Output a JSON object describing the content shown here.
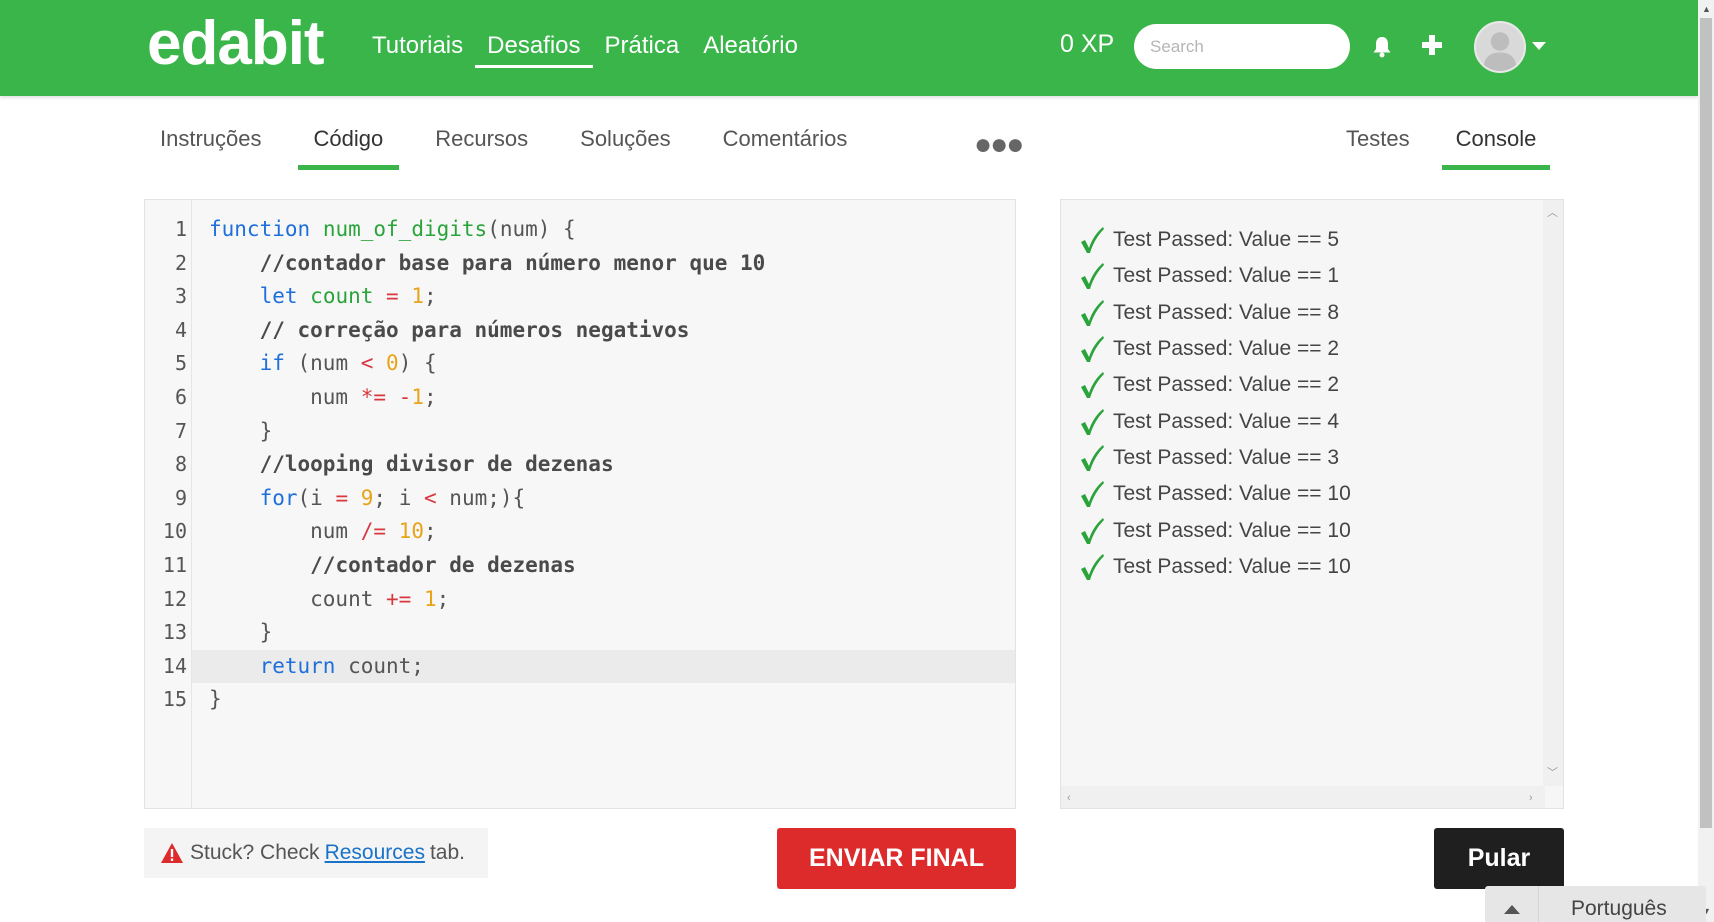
{
  "brand": {
    "logo": "edabit",
    "accent": "#39b54a"
  },
  "nav": [
    {
      "label": "Tutoriais",
      "active": false
    },
    {
      "label": "Desafios",
      "active": true
    },
    {
      "label": "Prática",
      "active": false
    },
    {
      "label": "Aleatório",
      "active": false
    }
  ],
  "header": {
    "xp": "0 XP",
    "search_placeholder": "Search",
    "icons": [
      "bell-icon",
      "plus-icon",
      "avatar",
      "caret-down-icon"
    ]
  },
  "tabs_left": [
    {
      "label": "Instruções",
      "active": false
    },
    {
      "label": "Código",
      "active": true
    },
    {
      "label": "Recursos",
      "active": false
    },
    {
      "label": "Soluções",
      "active": false
    },
    {
      "label": "Comentários",
      "active": false
    }
  ],
  "more_label": "●●●",
  "tabs_right": [
    {
      "label": "Testes",
      "active": false
    },
    {
      "label": "Console",
      "active": true
    }
  ],
  "code": {
    "highlighted_line": 14,
    "lines": [
      [
        [
          "k",
          "function"
        ],
        [
          "t",
          " "
        ],
        [
          "f",
          "num_of_digits"
        ],
        [
          "t",
          "(num) {"
        ]
      ],
      [
        [
          "t",
          "    "
        ],
        [
          "c",
          "//contador base para número menor que 10"
        ]
      ],
      [
        [
          "t",
          "    "
        ],
        [
          "k",
          "let"
        ],
        [
          "t",
          " "
        ],
        [
          "v",
          "count"
        ],
        [
          "t",
          " "
        ],
        [
          "o",
          "="
        ],
        [
          "t",
          " "
        ],
        [
          "n",
          "1"
        ],
        [
          "t",
          ";"
        ]
      ],
      [
        [
          "t",
          "    "
        ],
        [
          "c",
          "// correção para números negativos"
        ]
      ],
      [
        [
          "t",
          "    "
        ],
        [
          "k",
          "if"
        ],
        [
          "t",
          " (num "
        ],
        [
          "o",
          "<"
        ],
        [
          "t",
          " "
        ],
        [
          "n",
          "0"
        ],
        [
          "t",
          ") {"
        ]
      ],
      [
        [
          "t",
          "        num "
        ],
        [
          "o",
          "*="
        ],
        [
          "t",
          " "
        ],
        [
          "o",
          "-"
        ],
        [
          "n",
          "1"
        ],
        [
          "t",
          ";"
        ]
      ],
      [
        [
          "t",
          "    }"
        ]
      ],
      [
        [
          "t",
          "    "
        ],
        [
          "c",
          "//looping divisor de dezenas"
        ]
      ],
      [
        [
          "t",
          "    "
        ],
        [
          "k",
          "for"
        ],
        [
          "t",
          "(i "
        ],
        [
          "o",
          "="
        ],
        [
          "t",
          " "
        ],
        [
          "n",
          "9"
        ],
        [
          "t",
          "; i "
        ],
        [
          "o",
          "<"
        ],
        [
          "t",
          " num;){"
        ]
      ],
      [
        [
          "t",
          "        num "
        ],
        [
          "o",
          "/="
        ],
        [
          "t",
          " "
        ],
        [
          "n",
          "10"
        ],
        [
          "t",
          ";"
        ]
      ],
      [
        [
          "t",
          "        "
        ],
        [
          "c",
          "//contador de dezenas"
        ]
      ],
      [
        [
          "t",
          "        count "
        ],
        [
          "o",
          "+="
        ],
        [
          "t",
          " "
        ],
        [
          "n",
          "1"
        ],
        [
          "t",
          ";"
        ]
      ],
      [
        [
          "t",
          "    }"
        ]
      ],
      [
        [
          "t",
          "    "
        ],
        [
          "k",
          "return"
        ],
        [
          "t",
          " count;"
        ]
      ],
      [
        [
          "t",
          "}"
        ]
      ]
    ]
  },
  "console": {
    "check_color": "#2aa43a",
    "results": [
      "Test Passed: Value == 5",
      "Test Passed: Value == 1",
      "Test Passed: Value == 8",
      "Test Passed: Value == 2",
      "Test Passed: Value == 2",
      "Test Passed: Value == 4",
      "Test Passed: Value == 3",
      "Test Passed: Value == 10",
      "Test Passed: Value == 10",
      "Test Passed: Value == 10"
    ]
  },
  "bottom": {
    "stuck_prefix": "Stuck? Check",
    "stuck_link": "Resources",
    "stuck_suffix": "tab.",
    "submit_label": "ENVIAR FINAL",
    "submit_color": "#dd2a2a",
    "skip_label": "Pular",
    "language": "Português"
  }
}
